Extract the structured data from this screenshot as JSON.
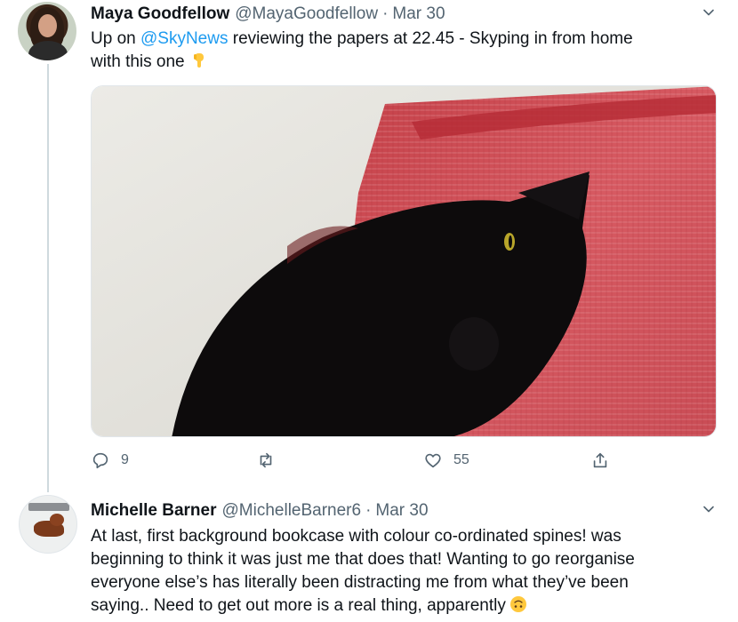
{
  "tweet1": {
    "name": "Maya Goodfellow",
    "handle": "@MayaGoodfellow",
    "dot": "·",
    "date": "Mar 30",
    "text_part1": "Up on ",
    "mention": "@SkyNews",
    "text_part2": " reviewing the papers at 22.45 - Skyping in from home",
    "text_line2": "with this one",
    "emoji": "backhand-index-pointing-down",
    "media_description": "black-cat-on-red-blanket",
    "actions": {
      "reply_count": "9",
      "retweet_count": "",
      "like_count": "55"
    }
  },
  "tweet2": {
    "name": "Michelle Barner",
    "handle": "@MichelleBarner6",
    "dot": "·",
    "date": "Mar 30",
    "lines": [
      "At last, first background bookcase with colour co-ordinated spines! was",
      "beginning to think it was just me that does that! Wanting to go reorganise",
      "everyone else’s has literally been distracting me from what they’ve been",
      "saying.. Need to get out more is a real thing, apparently"
    ],
    "emoji": "upside-down-face"
  },
  "colors": {
    "text": "#0f1419",
    "secondary": "#536471",
    "link": "#1d9bf0",
    "thread_line": "#cfd9de"
  }
}
